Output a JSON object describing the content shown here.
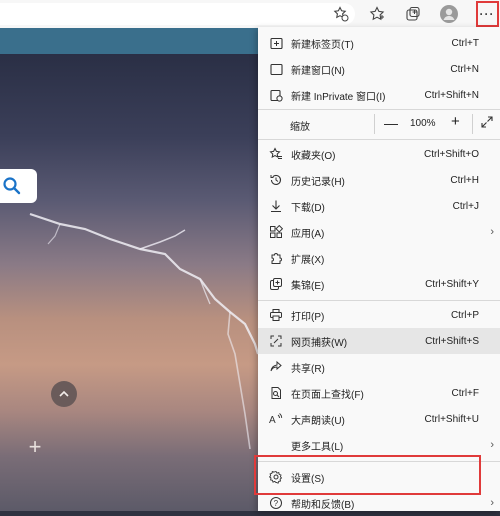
{
  "toolbar": {
    "icons": [
      "reading-add-icon",
      "favorites-star-icon",
      "collections-icon",
      "profile-avatar-icon",
      "more-options-icon"
    ],
    "more_label": "···"
  },
  "page": {
    "accent_lightning": "#ffffff"
  },
  "menu": {
    "new_tab": {
      "label": "新建标签页(T)",
      "shortcut": "Ctrl+T"
    },
    "new_window": {
      "label": "新建窗口(N)",
      "shortcut": "Ctrl+N"
    },
    "new_inprivate": {
      "label": "新建 InPrivate 窗口(I)",
      "shortcut": "Ctrl+Shift+N"
    },
    "zoom": {
      "label": "缩放",
      "minus": "—",
      "value": "100%",
      "plus": "+"
    },
    "favorites": {
      "label": "收藏夹(O)",
      "shortcut": "Ctrl+Shift+O"
    },
    "history": {
      "label": "历史记录(H)",
      "shortcut": "Ctrl+H"
    },
    "downloads": {
      "label": "下载(D)",
      "shortcut": "Ctrl+J"
    },
    "apps": {
      "label": "应用(A)",
      "chevron": "›"
    },
    "extensions": {
      "label": "扩展(X)"
    },
    "collections": {
      "label": "集锦(E)",
      "shortcut": "Ctrl+Shift+Y"
    },
    "print": {
      "label": "打印(P)",
      "shortcut": "Ctrl+P"
    },
    "web_capture": {
      "label": "网页捕获(W)",
      "shortcut": "Ctrl+Shift+S"
    },
    "share": {
      "label": "共享(R)"
    },
    "find": {
      "label": "在页面上查找(F)",
      "shortcut": "Ctrl+F"
    },
    "read_aloud": {
      "label": "大声朗读(U)",
      "shortcut": "Ctrl+Shift+U"
    },
    "more_tools": {
      "label": "更多工具(L)",
      "chevron": "›"
    },
    "settings": {
      "label": "设置(S)"
    },
    "help": {
      "label": "帮助和反馈(B)",
      "chevron": "›"
    }
  },
  "highlight_color": "#e03a3a"
}
